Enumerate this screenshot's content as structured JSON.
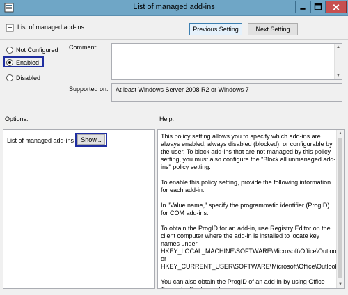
{
  "window": {
    "title": "List of managed add-ins",
    "app_icon": "policy-window-icon",
    "controls": {
      "minimize": "minimize-icon",
      "maximize": "maximize-icon",
      "close": "close-icon"
    }
  },
  "header": {
    "policy_name": "List of managed add-ins",
    "policy_icon": "policy-setting-icon",
    "prev_label": "Previous Setting",
    "next_label": "Next Setting"
  },
  "state": {
    "options": [
      {
        "label": "Not Configured",
        "selected": false
      },
      {
        "label": "Enabled",
        "selected": true
      },
      {
        "label": "Disabled",
        "selected": false
      }
    ]
  },
  "comment": {
    "label": "Comment:",
    "value": ""
  },
  "supported": {
    "label": "Supported on:",
    "value": "At least Windows Server 2008 R2 or Windows 7"
  },
  "options_section": {
    "label": "Options:",
    "item_label": "List of managed add-ins",
    "show_label": "Show..."
  },
  "help_section": {
    "label": "Help:",
    "paragraphs": [
      "This policy setting allows you to specify which add-ins are always enabled, always disabled (blocked), or configurable by the user. To block add-ins that are not managed by this policy setting, you must also configure the \"Block all unmanaged add-ins\" policy setting.",
      "To enable this policy setting, provide the following information for each add-in:",
      "In \"Value name,\" specify the programmatic identifier (ProgID) for COM add-ins.",
      "To obtain the ProgID for an add-in, use Registry Editor on the client computer where the add-in is installed to locate key names under HKEY_LOCAL_MACHINE\\SOFTWARE\\Microsoft\\Office\\Outlook\\Addins or HKEY_CURRENT_USER\\SOFTWARE\\Microsoft\\Office\\Outlook\\Addins.",
      "You can also obtain the ProgID of an add-in by using Office Telemetry Dashboard."
    ]
  },
  "colors": {
    "titlebar": "#6fa6c6",
    "close": "#c75050",
    "highlight": "#1f2ea0"
  }
}
